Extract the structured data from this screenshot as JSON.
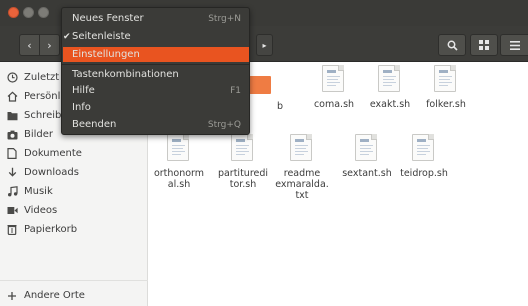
{
  "window": {
    "controls": [
      "close-icon",
      "minimize-icon",
      "maximize-icon"
    ]
  },
  "toolbar": {
    "back_glyph": "‹",
    "forward_glyph": "›",
    "path_next_glyph": "▸",
    "search_glyph": "⚲",
    "view_glyph": "▪▪",
    "menu_glyph": "≡"
  },
  "app_menu": {
    "items": [
      {
        "label": "Neues Fenster",
        "shortcut": "Strg+N"
      },
      {
        "label": "Seitenleiste",
        "checked": true
      },
      {
        "label": "Einstellungen",
        "selected": true
      },
      {
        "label": "Tastenkombinationen"
      },
      {
        "label": "Hilfe",
        "shortcut": "F1"
      },
      {
        "label": "Info"
      },
      {
        "label": "Beenden",
        "shortcut": "Strg+Q"
      }
    ],
    "check_glyph": "✔",
    "accent_color": "#e95420"
  },
  "sidebar": {
    "items": [
      {
        "label": "Zuletzt",
        "icon": "clock-icon"
      },
      {
        "label": "Persönlicher Ordner",
        "icon": "home-icon"
      },
      {
        "label": "Schreibtisch",
        "icon": "folder-icon"
      },
      {
        "label": "Bilder",
        "icon": "camera-icon"
      },
      {
        "label": "Dokumente",
        "icon": "document-icon"
      },
      {
        "label": "Downloads",
        "icon": "download-icon"
      },
      {
        "label": "Musik",
        "icon": "music-icon"
      },
      {
        "label": "Videos",
        "icon": "video-icon"
      },
      {
        "label": "Papierkorb",
        "icon": "trash-icon"
      },
      {
        "label": "Andere Orte",
        "icon": "plus-icon"
      }
    ]
  },
  "files": [
    {
      "name": "b"
    },
    {
      "name": "coma.sh"
    },
    {
      "name": "exakt.sh"
    },
    {
      "name": "folker.sh"
    },
    {
      "name": "orthonorm\nal.sh"
    },
    {
      "name": "partituredi\ntor.sh"
    },
    {
      "name": "readme\nexmaralda.\ntxt"
    },
    {
      "name": "sextant.sh"
    },
    {
      "name": "teidrop.sh"
    }
  ]
}
